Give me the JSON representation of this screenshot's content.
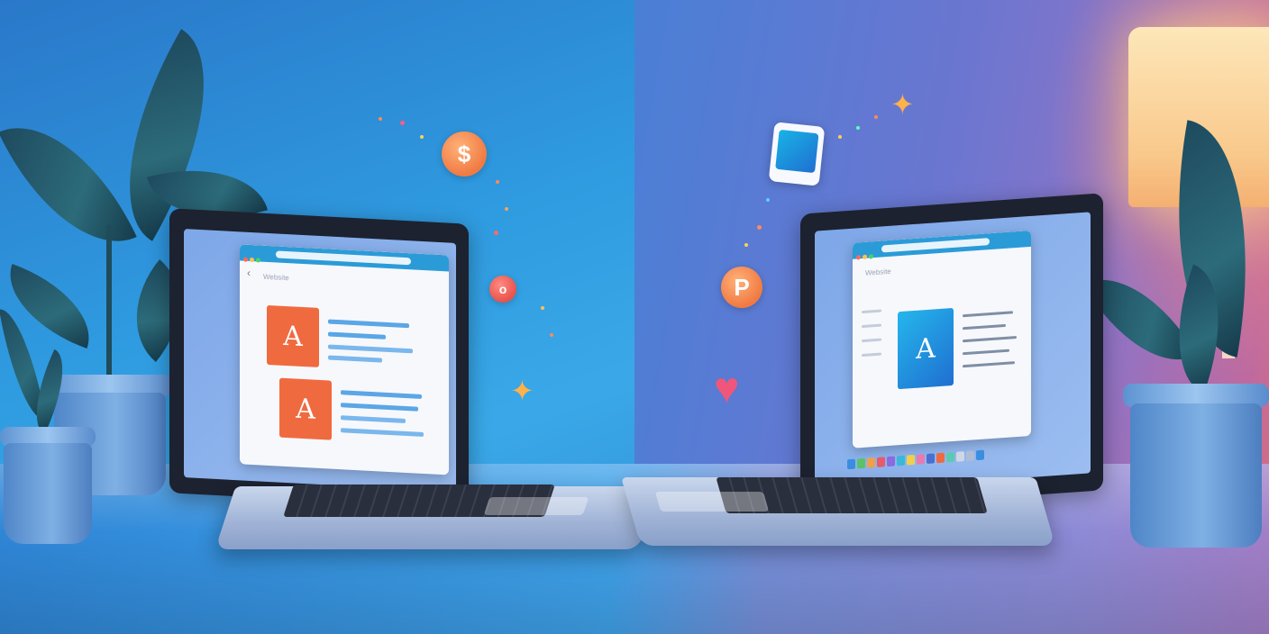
{
  "scene": {
    "description_colors": {
      "left_bg": "#2f9be0",
      "right_bg": "#7a78d0",
      "accent_orange": "#f07a42",
      "accent_blue": "#1f8fe0"
    }
  },
  "left_laptop": {
    "window_title": "Website",
    "tile_glyph_1": "A",
    "tile_glyph_2": "A",
    "tile_color": "#f06a40"
  },
  "right_laptop": {
    "window_title": "Website",
    "tile_glyph": "A",
    "tile_color": "#1f8fe0"
  },
  "floating": {
    "coin_dollar": "$",
    "coin_small": "o",
    "coin_p": "P",
    "sparkle": "✦",
    "heart": "♥"
  }
}
